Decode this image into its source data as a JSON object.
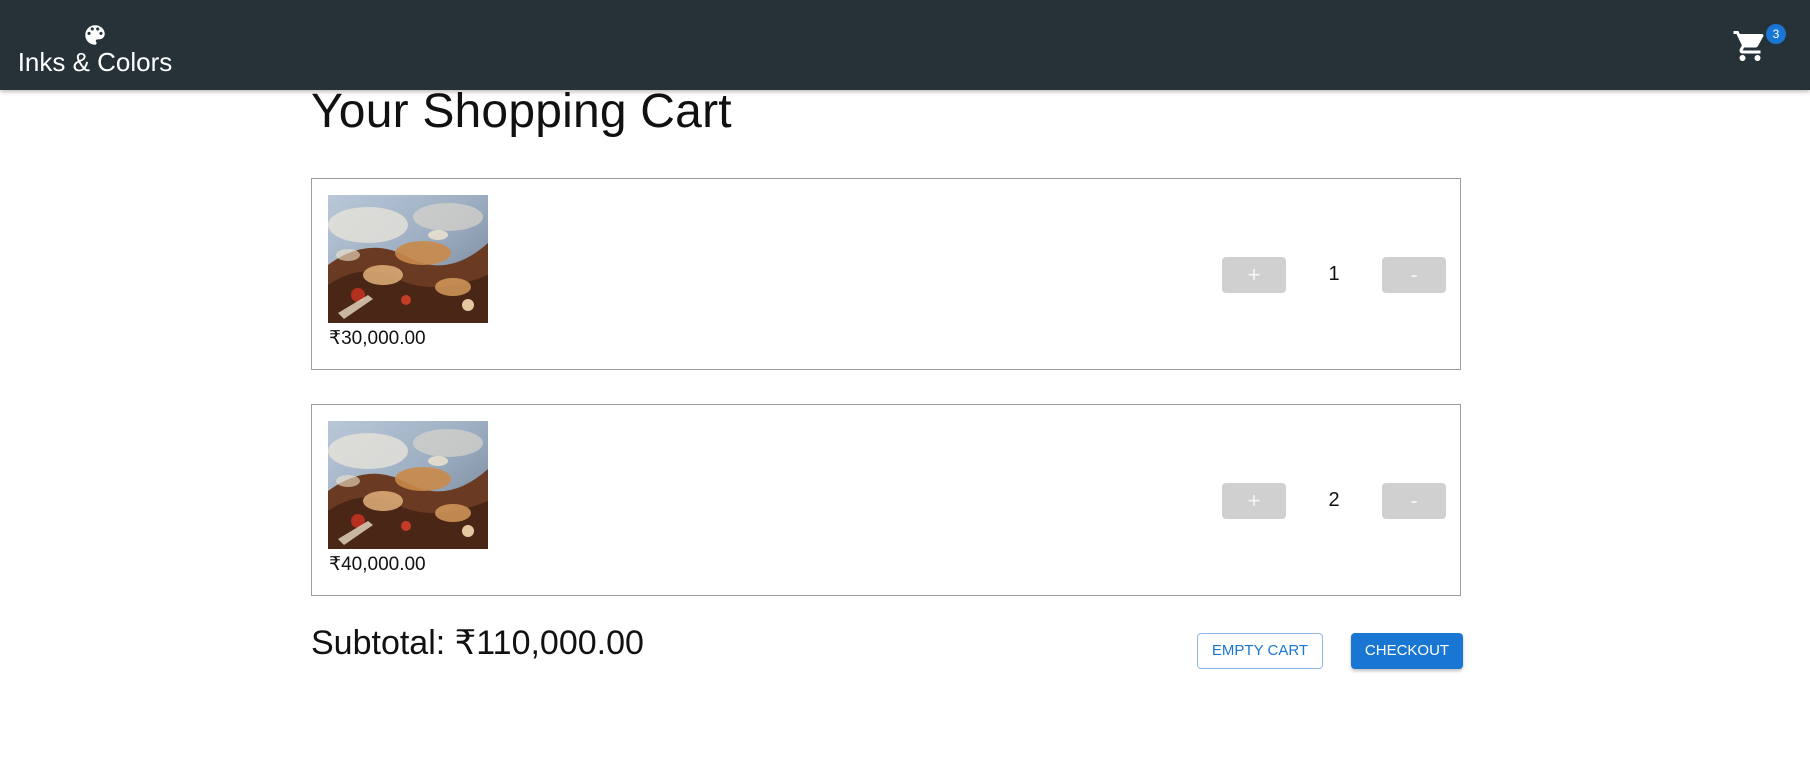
{
  "header": {
    "brand_name": "Inks & Colors",
    "brand_icon": "palette-icon",
    "cart_icon": "shopping-cart-icon",
    "cart_count": "3",
    "background_color": "#263238",
    "badge_color": "#1976d2"
  },
  "page_title": "Your Shopping Cart",
  "items": [
    {
      "price": "₹30,000.00",
      "quantity": "1",
      "plus_label": "+",
      "minus_label": "-"
    },
    {
      "price": "₹40,000.00",
      "quantity": "2",
      "plus_label": "+",
      "minus_label": "-"
    }
  ],
  "summary": {
    "subtotal": "Subtotal: ₹110,000.00",
    "empty_cart_label": "EMPTY CART",
    "checkout_label": "CHECKOUT"
  },
  "colors": {
    "primary": "#1976d2",
    "qty_button": "#d0d0d0"
  }
}
